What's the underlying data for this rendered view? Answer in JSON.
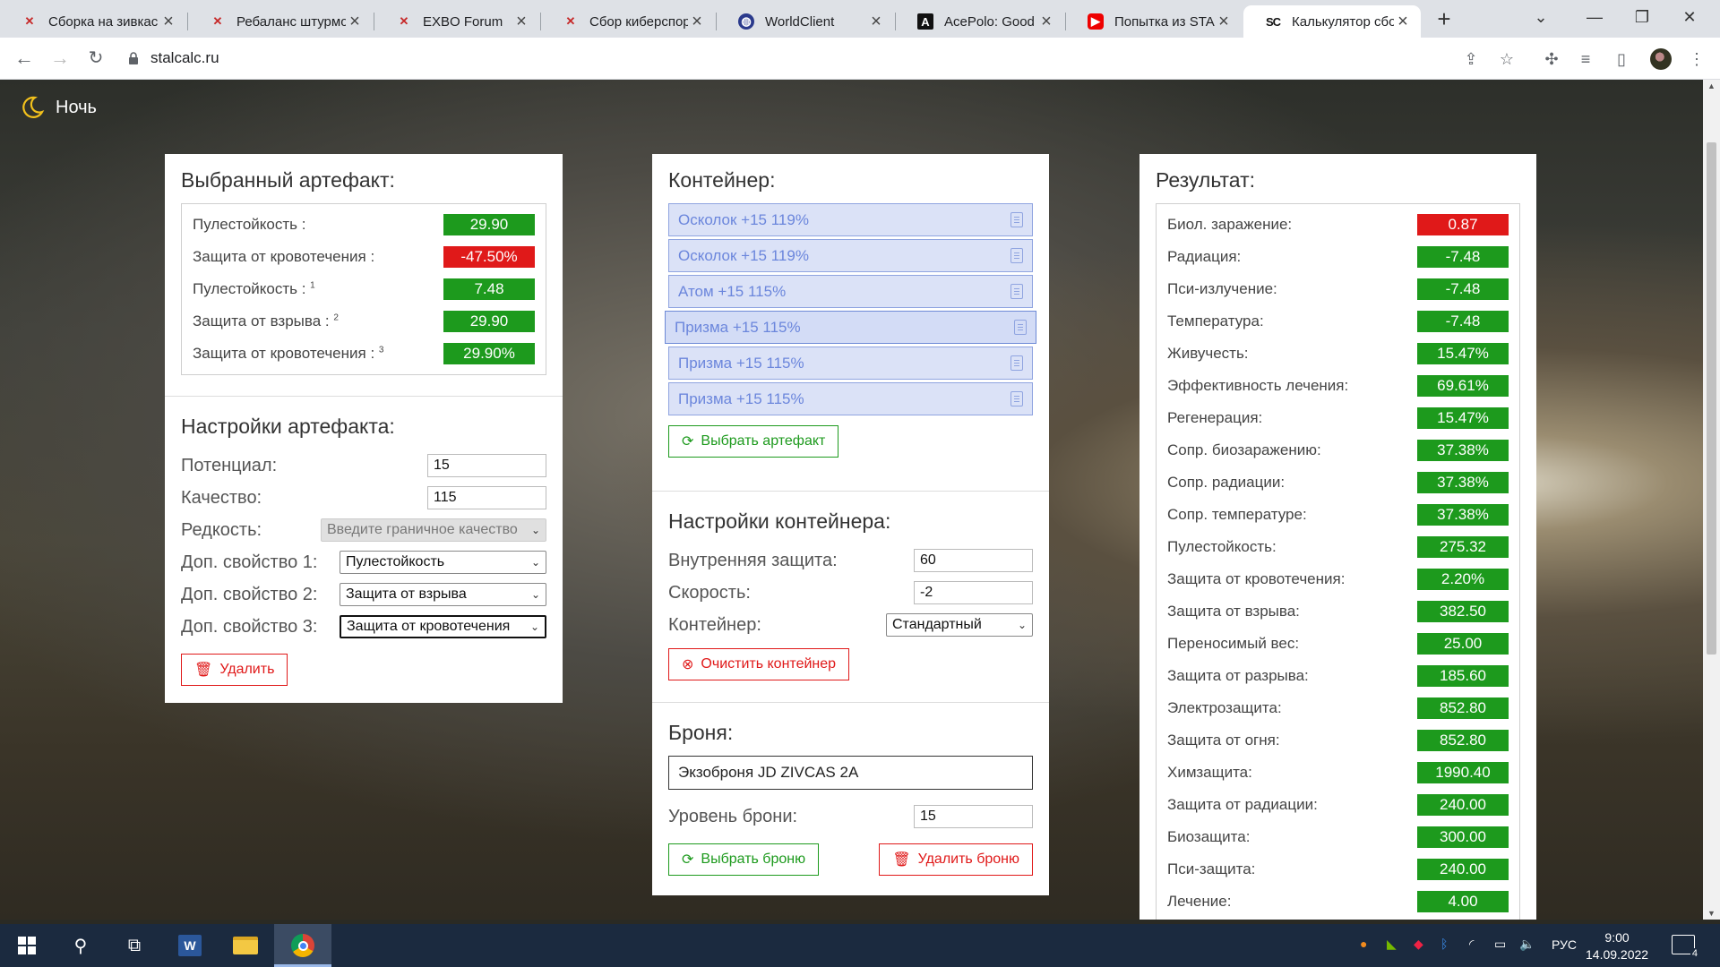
{
  "browser": {
    "tabs": [
      {
        "title": "Сборка на зивкас",
        "favicon": "exbo-x-icon"
      },
      {
        "title": "Ребаланс штурмо",
        "favicon": "exbo-x-icon"
      },
      {
        "title": "EXBO Forum",
        "favicon": "exbo-x-icon"
      },
      {
        "title": "Сбор киберспорт",
        "favicon": "exbo-x-icon"
      },
      {
        "title": "WorldClient",
        "favicon": "globe-icon"
      },
      {
        "title": "AcePolo: Good",
        "favicon": "acepolo-icon"
      },
      {
        "title": "Попытка из STAL",
        "favicon": "youtube-icon"
      },
      {
        "title": "Калькулятор сбо",
        "favicon": "stalcalc-icon",
        "active": true
      }
    ],
    "url": "stalcalc.ru"
  },
  "page": {
    "theme_toggle": "Ночь",
    "artifact": {
      "title": "Выбранный артефакт:",
      "props": [
        {
          "label": "Пулестойкость :",
          "sup": "",
          "value": "29.90",
          "color": "green"
        },
        {
          "label": "Защита от кровотечения :",
          "sup": "",
          "value": "-47.50%",
          "color": "red"
        },
        {
          "label": "Пулестойкость :",
          "sup": "1",
          "value": "7.48",
          "color": "green"
        },
        {
          "label": "Защита от взрыва :",
          "sup": "2",
          "value": "29.90",
          "color": "green"
        },
        {
          "label": "Защита от кровотечения :",
          "sup": "3",
          "value": "29.90%",
          "color": "green"
        }
      ]
    },
    "artifact_settings": {
      "title": "Настройки артефакта:",
      "potential_label": "Потенциал:",
      "potential_value": "15",
      "quality_label": "Качество:",
      "quality_value": "115",
      "rarity_label": "Редкость:",
      "rarity_value": "Введите граничное качество",
      "extra1_label": "Доп. свойство 1:",
      "extra1_value": "Пулестойкость",
      "extra2_label": "Доп. свойство 2:",
      "extra2_value": "Защита от взрыва",
      "extra3_label": "Доп. свойство 3:",
      "extra3_value": "Защита от кровотечения",
      "delete_label": "Удалить"
    },
    "container": {
      "title": "Контейнер:",
      "items": [
        "Осколок +15 119%",
        "Осколок +15 119%",
        "Атом +15 115%",
        "Призма +15 115%",
        "Призма +15 115%",
        "Призма +15 115%"
      ],
      "select_artifact_label": "Выбрать артефакт"
    },
    "container_settings": {
      "title": "Настройки контейнера:",
      "inner_protection_label": "Внутренняя защита:",
      "inner_protection_value": "60",
      "speed_label": "Скорость:",
      "speed_value": "-2",
      "container_label": "Контейнер:",
      "container_value": "Стандартный",
      "clear_label": "Очистить контейнер"
    },
    "armor": {
      "title": "Броня:",
      "name": "Экзоброня JD ZIVCAS 2A",
      "level_label": "Уровень брони:",
      "level_value": "15",
      "select_label": "Выбрать броню",
      "delete_label": "Удалить броню"
    },
    "result": {
      "title": "Результат:",
      "rows": [
        {
          "label": "Биол. заражение:",
          "value": "0.87",
          "color": "red"
        },
        {
          "label": "Радиация:",
          "value": "-7.48",
          "color": "green"
        },
        {
          "label": "Пси-излучение:",
          "value": "-7.48",
          "color": "green"
        },
        {
          "label": "Температура:",
          "value": "-7.48",
          "color": "green"
        },
        {
          "label": "Живучесть:",
          "value": "15.47%",
          "color": "green"
        },
        {
          "label": "Эффективность лечения:",
          "value": "69.61%",
          "color": "green"
        },
        {
          "label": "Регенерация:",
          "value": "15.47%",
          "color": "green"
        },
        {
          "label": "Сопр. биозаражению:",
          "value": "37.38%",
          "color": "green"
        },
        {
          "label": "Сопр. радиации:",
          "value": "37.38%",
          "color": "green"
        },
        {
          "label": "Сопр. температуре:",
          "value": "37.38%",
          "color": "green"
        },
        {
          "label": "Пулестойкость:",
          "value": "275.32",
          "color": "green"
        },
        {
          "label": "Защита от кровотечения:",
          "value": "2.20%",
          "color": "green"
        },
        {
          "label": "Защита от взрыва:",
          "value": "382.50",
          "color": "green"
        },
        {
          "label": "Переносимый вес:",
          "value": "25.00",
          "color": "green"
        },
        {
          "label": "Защита от разрыва:",
          "value": "185.60",
          "color": "green"
        },
        {
          "label": "Электрозащита:",
          "value": "852.80",
          "color": "green"
        },
        {
          "label": "Защита от огня:",
          "value": "852.80",
          "color": "green"
        },
        {
          "label": "Химзащита:",
          "value": "1990.40",
          "color": "green"
        },
        {
          "label": "Защита от радиации:",
          "value": "240.00",
          "color": "green"
        },
        {
          "label": "Биозащита:",
          "value": "300.00",
          "color": "green"
        },
        {
          "label": "Пси-защита:",
          "value": "240.00",
          "color": "green"
        },
        {
          "label": "Лечение:",
          "value": "4.00",
          "color": "green"
        }
      ]
    }
  },
  "colors": {
    "green": "#1d9a1d",
    "red": "#e01919",
    "container_item_bg": "#dbe2f7",
    "container_item_text": "#6b86dc"
  },
  "taskbar": {
    "apps": [
      "windows-start-icon",
      "search-icon",
      "task-view-icon",
      "word-icon",
      "file-explorer-icon",
      "chrome-icon"
    ],
    "lang": "РУС",
    "time": "9:00",
    "date": "14.09.2022",
    "notifications": "4"
  }
}
